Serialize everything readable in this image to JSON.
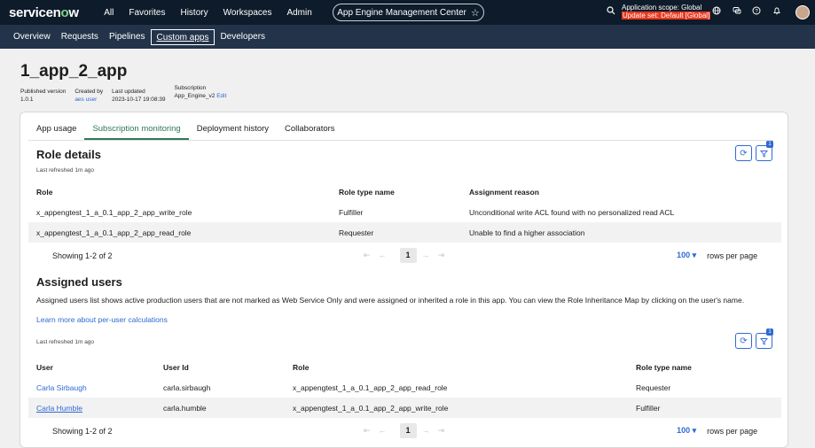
{
  "topbar": {
    "logo_main": "servicen",
    "logo_o": "o",
    "logo_end": "w",
    "nav": [
      "All",
      "Favorites",
      "History",
      "Workspaces",
      "Admin"
    ],
    "app_pill": "App Engine Management Center",
    "scope_line1": "Application scope: Global",
    "scope_line2": "Update set: Default [Global]"
  },
  "subnav": {
    "items": [
      "Overview",
      "Requests",
      "Pipelines",
      "Custom apps",
      "Developers"
    ],
    "active": "Custom apps"
  },
  "header": {
    "title": "1_app_2_app",
    "meta": [
      {
        "label": "Published version",
        "value": "1.0.1"
      },
      {
        "label": "Created by",
        "value": "aes user"
      },
      {
        "label": "Last updated",
        "value": "2023-10-17 19:08:39"
      },
      {
        "label": "Subscription",
        "value": "App_Engine_v2",
        "edit": "Edit"
      }
    ]
  },
  "tabs": [
    "App usage",
    "Subscription monitoring",
    "Deployment history",
    "Collaborators"
  ],
  "role_details": {
    "title": "Role details",
    "last_refreshed": "Last refreshed 1m ago",
    "filter_count": "1",
    "columns": [
      "Role",
      "Role type name",
      "Assignment reason"
    ],
    "rows": [
      [
        "x_appengtest_1_a_0.1_app_2_app_write_role",
        "Fulfiller",
        "Unconditional write ACL found with no personalized read ACL"
      ],
      [
        "x_appengtest_1_a_0.1_app_2_app_read_role",
        "Requester",
        "Unable to find a higher association"
      ]
    ],
    "showing": "Showing 1-2 of 2",
    "page": "1",
    "rows_per_page_value": "100",
    "rows_per_page_label": "rows per page"
  },
  "assigned_users": {
    "title": "Assigned users",
    "description": "Assigned users list shows active production users that are not marked as Web Service Only and were assigned or inherited a role in this app. You can view the Role Inheritance Map by clicking on the user's name.",
    "learn_more": "Learn more about per-user calculations",
    "last_refreshed": "Last refreshed 1m ago",
    "filter_count": "1",
    "columns": [
      "User",
      "User Id",
      "Role",
      "Role type name"
    ],
    "rows": [
      [
        "Carla Sirbaugh",
        "carla.sirbaugh",
        "x_appengtest_1_a_0.1_app_2_app_read_role",
        "Requester"
      ],
      [
        "Carla Humble",
        "carla.humble",
        "x_appengtest_1_a_0.1_app_2_app_write_role",
        "Fulfiller"
      ]
    ],
    "showing": "Showing 1-2 of 2",
    "page": "1",
    "rows_per_page_value": "100",
    "rows_per_page_label": "rows per page"
  },
  "colors": {
    "topbar": "#0d1b2a",
    "subbar": "#23334a",
    "accent_link": "#2f6ad3",
    "tab_active": "#2e7a56",
    "update_set_bg": "#e8361e"
  }
}
